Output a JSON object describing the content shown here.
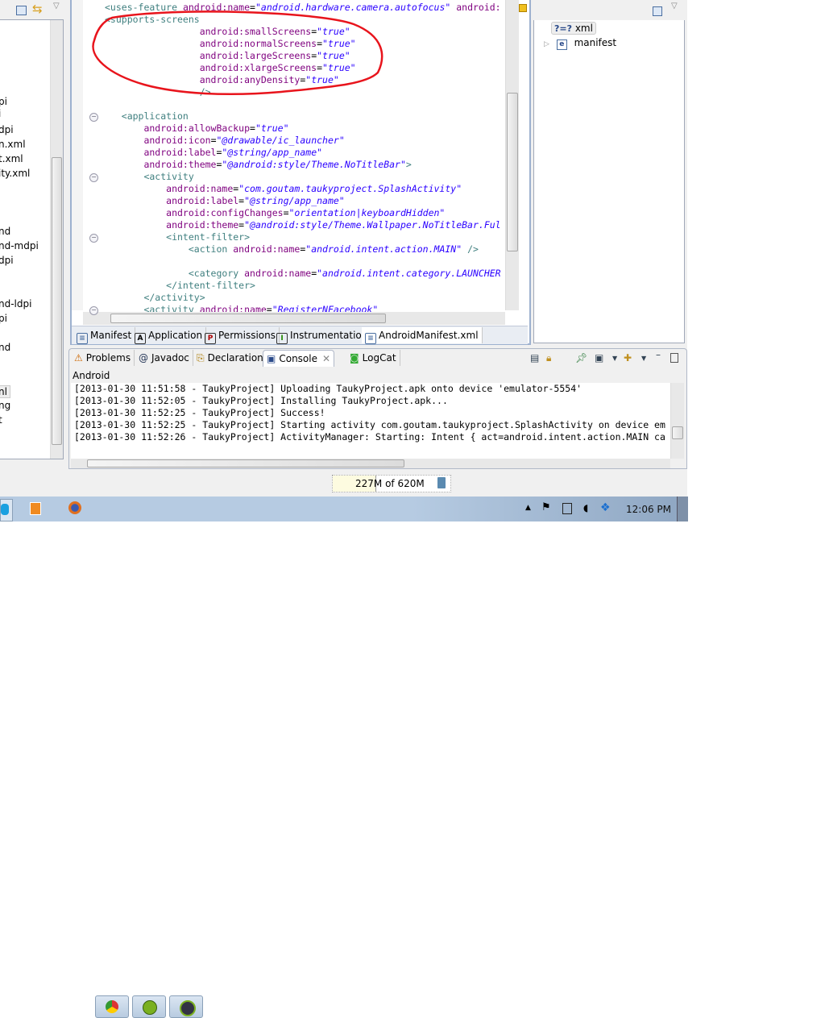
{
  "explorer": {
    "items": [
      {
        "label": "pi"
      },
      {
        "label": "i"
      },
      {
        "label": "dpi"
      },
      {
        "label": "n.xml"
      },
      {
        "label": "t.xml"
      },
      {
        "label": "ity.xml"
      },
      {
        "label": "nd"
      },
      {
        "label": "nd-mdpi"
      },
      {
        "label": "dpi"
      },
      {
        "label": "nd-ldpi"
      },
      {
        "label": "pi"
      },
      {
        "label": "nd"
      },
      {
        "label": "nl",
        "selected": true
      },
      {
        "label": "ng"
      },
      {
        "label": "t"
      }
    ]
  },
  "editor": {
    "code": [
      [
        {
          "t": "<uses-feature ",
          "c": "tag"
        },
        {
          "t": "android:name",
          "c": "attr"
        },
        {
          "t": "=",
          "c": "plain"
        },
        {
          "t": "\"android.hardware.camera.autofocus\"",
          "c": "val"
        },
        {
          "t": " android:",
          "c": "attr"
        }
      ],
      [
        {
          "t": "<supports-screens",
          "c": "tag"
        }
      ],
      [
        {
          "t": "                 android:smallScreens",
          "c": "attr"
        },
        {
          "t": "=",
          "c": "plain"
        },
        {
          "t": "\"true\"",
          "c": "val"
        }
      ],
      [
        {
          "t": "                 android:normalScreens",
          "c": "attr"
        },
        {
          "t": "=",
          "c": "plain"
        },
        {
          "t": "\"true\"",
          "c": "val"
        }
      ],
      [
        {
          "t": "                 android:largeScreens",
          "c": "attr"
        },
        {
          "t": "=",
          "c": "plain"
        },
        {
          "t": "\"true\"",
          "c": "val"
        }
      ],
      [
        {
          "t": "                 android:xlargeScreens",
          "c": "attr"
        },
        {
          "t": "=",
          "c": "plain"
        },
        {
          "t": "\"true\"",
          "c": "val"
        }
      ],
      [
        {
          "t": "                 android:anyDensity",
          "c": "attr"
        },
        {
          "t": "=",
          "c": "plain"
        },
        {
          "t": "\"true\"",
          "c": "val"
        }
      ],
      [
        {
          "t": "                 />",
          "c": "tag"
        }
      ],
      [],
      [
        {
          "t": "   <application",
          "c": "tag"
        }
      ],
      [
        {
          "t": "       android:allowBackup",
          "c": "attr"
        },
        {
          "t": "=",
          "c": "plain"
        },
        {
          "t": "\"true\"",
          "c": "val"
        }
      ],
      [
        {
          "t": "       android:icon",
          "c": "attr"
        },
        {
          "t": "=",
          "c": "plain"
        },
        {
          "t": "\"@drawable/ic_launcher\"",
          "c": "val"
        }
      ],
      [
        {
          "t": "       android:label",
          "c": "attr"
        },
        {
          "t": "=",
          "c": "plain"
        },
        {
          "t": "\"@string/app_name\"",
          "c": "val"
        }
      ],
      [
        {
          "t": "       android:theme",
          "c": "attr"
        },
        {
          "t": "=",
          "c": "plain"
        },
        {
          "t": "\"@android:style/Theme.NoTitleBar\"",
          "c": "val"
        },
        {
          "t": ">",
          "c": "tag"
        }
      ],
      [
        {
          "t": "       <activity",
          "c": "tag"
        }
      ],
      [
        {
          "t": "           android:name",
          "c": "attr"
        },
        {
          "t": "=",
          "c": "plain"
        },
        {
          "t": "\"com.goutam.taukyproject.SplashActivity\"",
          "c": "val"
        }
      ],
      [
        {
          "t": "           android:label",
          "c": "attr"
        },
        {
          "t": "=",
          "c": "plain"
        },
        {
          "t": "\"@string/app_name\"",
          "c": "val"
        }
      ],
      [
        {
          "t": "           android:configChanges",
          "c": "attr"
        },
        {
          "t": "=",
          "c": "plain"
        },
        {
          "t": "\"orientation|keyboardHidden\"",
          "c": "val"
        }
      ],
      [
        {
          "t": "           android:theme",
          "c": "attr"
        },
        {
          "t": "=",
          "c": "plain"
        },
        {
          "t": "\"@android:style/Theme.Wallpaper.NoTitleBar.Ful",
          "c": "val"
        }
      ],
      [
        {
          "t": "           <intent-filter>",
          "c": "tag"
        }
      ],
      [
        {
          "t": "               <action ",
          "c": "tag"
        },
        {
          "t": "android:name",
          "c": "attr"
        },
        {
          "t": "=",
          "c": "plain"
        },
        {
          "t": "\"android.intent.action.MAIN\"",
          "c": "val"
        },
        {
          "t": " />",
          "c": "tag"
        }
      ],
      [],
      [
        {
          "t": "               <category ",
          "c": "tag"
        },
        {
          "t": "android:name",
          "c": "attr"
        },
        {
          "t": "=",
          "c": "plain"
        },
        {
          "t": "\"android.intent.category.LAUNCHER",
          "c": "val"
        }
      ],
      [
        {
          "t": "           </intent-filter>",
          "c": "tag"
        }
      ],
      [
        {
          "t": "       </activity>",
          "c": "tag"
        }
      ],
      [
        {
          "t": "       <activity ",
          "c": "tag"
        },
        {
          "t": "android:name",
          "c": "attr"
        },
        {
          "t": "=",
          "c": "plain"
        },
        {
          "t": "\"RegisterNFacebook\"",
          "c": "val"
        }
      ]
    ],
    "tabs": [
      {
        "label": "Manifest",
        "icon": "manifest-icon"
      },
      {
        "label": "Application",
        "icon": "A"
      },
      {
        "label": "Permissions",
        "icon": "P"
      },
      {
        "label": "Instrumentation",
        "icon": "I"
      },
      {
        "label": "AndroidManifest.xml",
        "icon": "xml-icon",
        "active": true
      }
    ],
    "annotation_color": "#e8141c"
  },
  "outline": {
    "items": [
      {
        "label": "xml",
        "icon": "?=?"
      },
      {
        "label": "manifest",
        "icon": "e"
      }
    ]
  },
  "console": {
    "tabs": [
      {
        "label": "Problems"
      },
      {
        "label": "Javadoc"
      },
      {
        "label": "Declaration"
      },
      {
        "label": "Console",
        "active": true
      },
      {
        "label": "LogCat"
      }
    ],
    "title": "Android",
    "lines": [
      "[2013-01-30 11:51:58 - TaukyProject] Uploading TaukyProject.apk onto device 'emulator-5554'",
      "[2013-01-30 11:52:05 - TaukyProject] Installing TaukyProject.apk...",
      "[2013-01-30 11:52:25 - TaukyProject] Success!",
      "[2013-01-30 11:52:25 - TaukyProject] Starting activity com.goutam.taukyproject.SplashActivity on device em",
      "[2013-01-30 11:52:26 - TaukyProject] ActivityManager: Starting: Intent { act=android.intent.action.MAIN ca"
    ]
  },
  "status": {
    "heap": "227M of 620M",
    "heap_used_fraction": 0.366
  },
  "taskbar": {
    "apps": [
      "skype",
      "media-player",
      "firefox",
      "chrome",
      "android-tool",
      "terminal"
    ],
    "clock": "12:06 PM"
  }
}
